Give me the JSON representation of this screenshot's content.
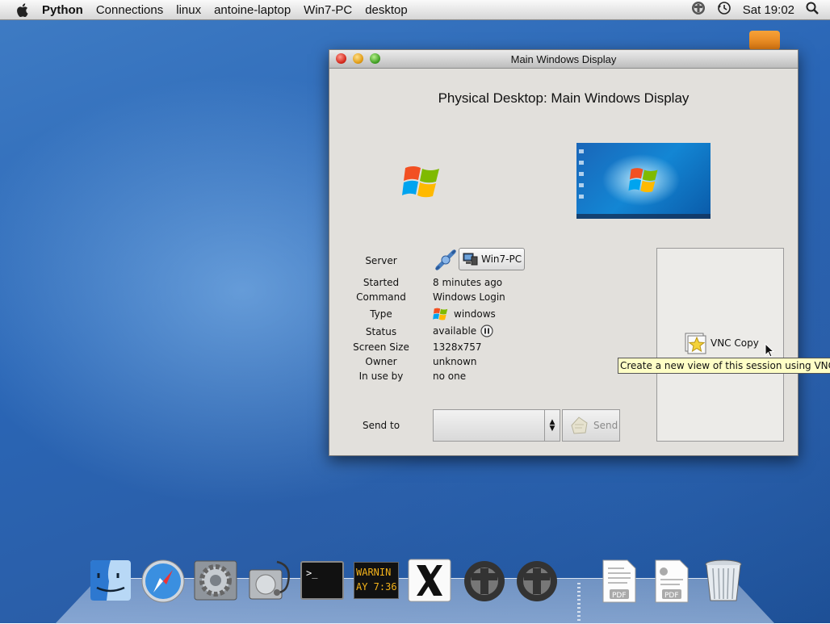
{
  "menubar": {
    "apple_icon": "apple-icon",
    "app_name": "Python",
    "items": [
      "Connections",
      "linux",
      "antoine-laptop",
      "Win7-PC",
      "desktop"
    ],
    "clock": "Sat 19:02"
  },
  "window": {
    "title": "Main Windows Display",
    "session_title": "Physical Desktop: Main Windows Display",
    "details": {
      "server_label": "Server",
      "server_value": "Win7-PC",
      "started_label": "Started",
      "started_value": "8 minutes ago",
      "command_label": "Command",
      "command_value": "Windows Login",
      "type_label": "Type",
      "type_value": "windows",
      "status_label": "Status",
      "status_value": "available",
      "screen_size_label": "Screen Size",
      "screen_size_value": "1328x757",
      "owner_label": "Owner",
      "owner_value": "unknown",
      "in_use_label": "In use by",
      "in_use_value": "no one"
    },
    "send_to_label": "Send to",
    "send_to_value": "",
    "send_button": "Send",
    "vnc_copy_button": "VNC Copy",
    "tooltip": "Create a new view of this session using VNC"
  },
  "dock": {
    "items": [
      "finder-icon",
      "safari-icon",
      "system-preferences-icon",
      "disk-utility-icon",
      "terminal-icon",
      "console-icon",
      "x11-icon",
      "winswitch-icon",
      "winswitch-icon",
      "pdf-document-icon",
      "pdf-document-icon",
      "trash-icon"
    ],
    "console_text_line1": "WARNIN",
    "console_text_line2": "AY 7:36"
  },
  "colors": {
    "desktop_blue": "#2a66b6",
    "window_bg": "#e2e0dc",
    "tooltip_bg": "#ffffc6"
  }
}
